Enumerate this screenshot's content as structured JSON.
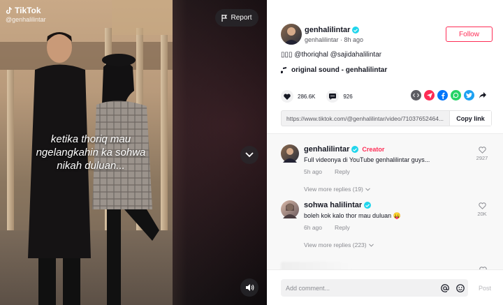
{
  "video": {
    "brand": "TikTok",
    "handle": "@genhalilintar",
    "caption_line1": "ketika thoriq mau",
    "caption_line2": "ngelangkahin ka sohwa",
    "caption_line3": "nikah duluan...",
    "report_label": "Report"
  },
  "post": {
    "username": "genhalilintar",
    "meta": "genhalilintar · 8h ago",
    "follow_label": "Follow",
    "description": "▯▯▯ @thoriqhal @sajidahalilintar",
    "sound": "original sound - genhalilintar",
    "likes": "286.6K",
    "comments": "926",
    "link": "https://www.tiktok.com/@genhalilintar/video/71037652464...",
    "copy_label": "Copy link"
  },
  "comments": [
    {
      "name": "genhalilintar",
      "badge": "Creator",
      "text": "Full videonya di YouTube genhalilintar guys...",
      "time": "5h ago",
      "reply": "Reply",
      "likes": "2927",
      "view_more": "View more replies (19)"
    },
    {
      "name": "sohwa halilintar",
      "badge": "",
      "text": "boleh kok kalo thor mau duluan 😛",
      "time": "6h ago",
      "reply": "Reply",
      "likes": "20K",
      "view_more": "View more replies (223)"
    }
  ],
  "footer": {
    "placeholder": "Add comment...",
    "post_label": "Post"
  },
  "colors": {
    "accent": "#fe2c55",
    "verified": "#20d5ec"
  },
  "icons": [
    "tiktok-logo-icon",
    "flag-icon",
    "chevron-down-icon",
    "volume-icon",
    "verified-icon",
    "music-note-icon",
    "heart-icon",
    "comment-icon",
    "embed-icon",
    "send-icon",
    "facebook-icon",
    "whatsapp-icon",
    "twitter-icon",
    "share-arrow-icon",
    "at-icon",
    "emoji-icon"
  ]
}
